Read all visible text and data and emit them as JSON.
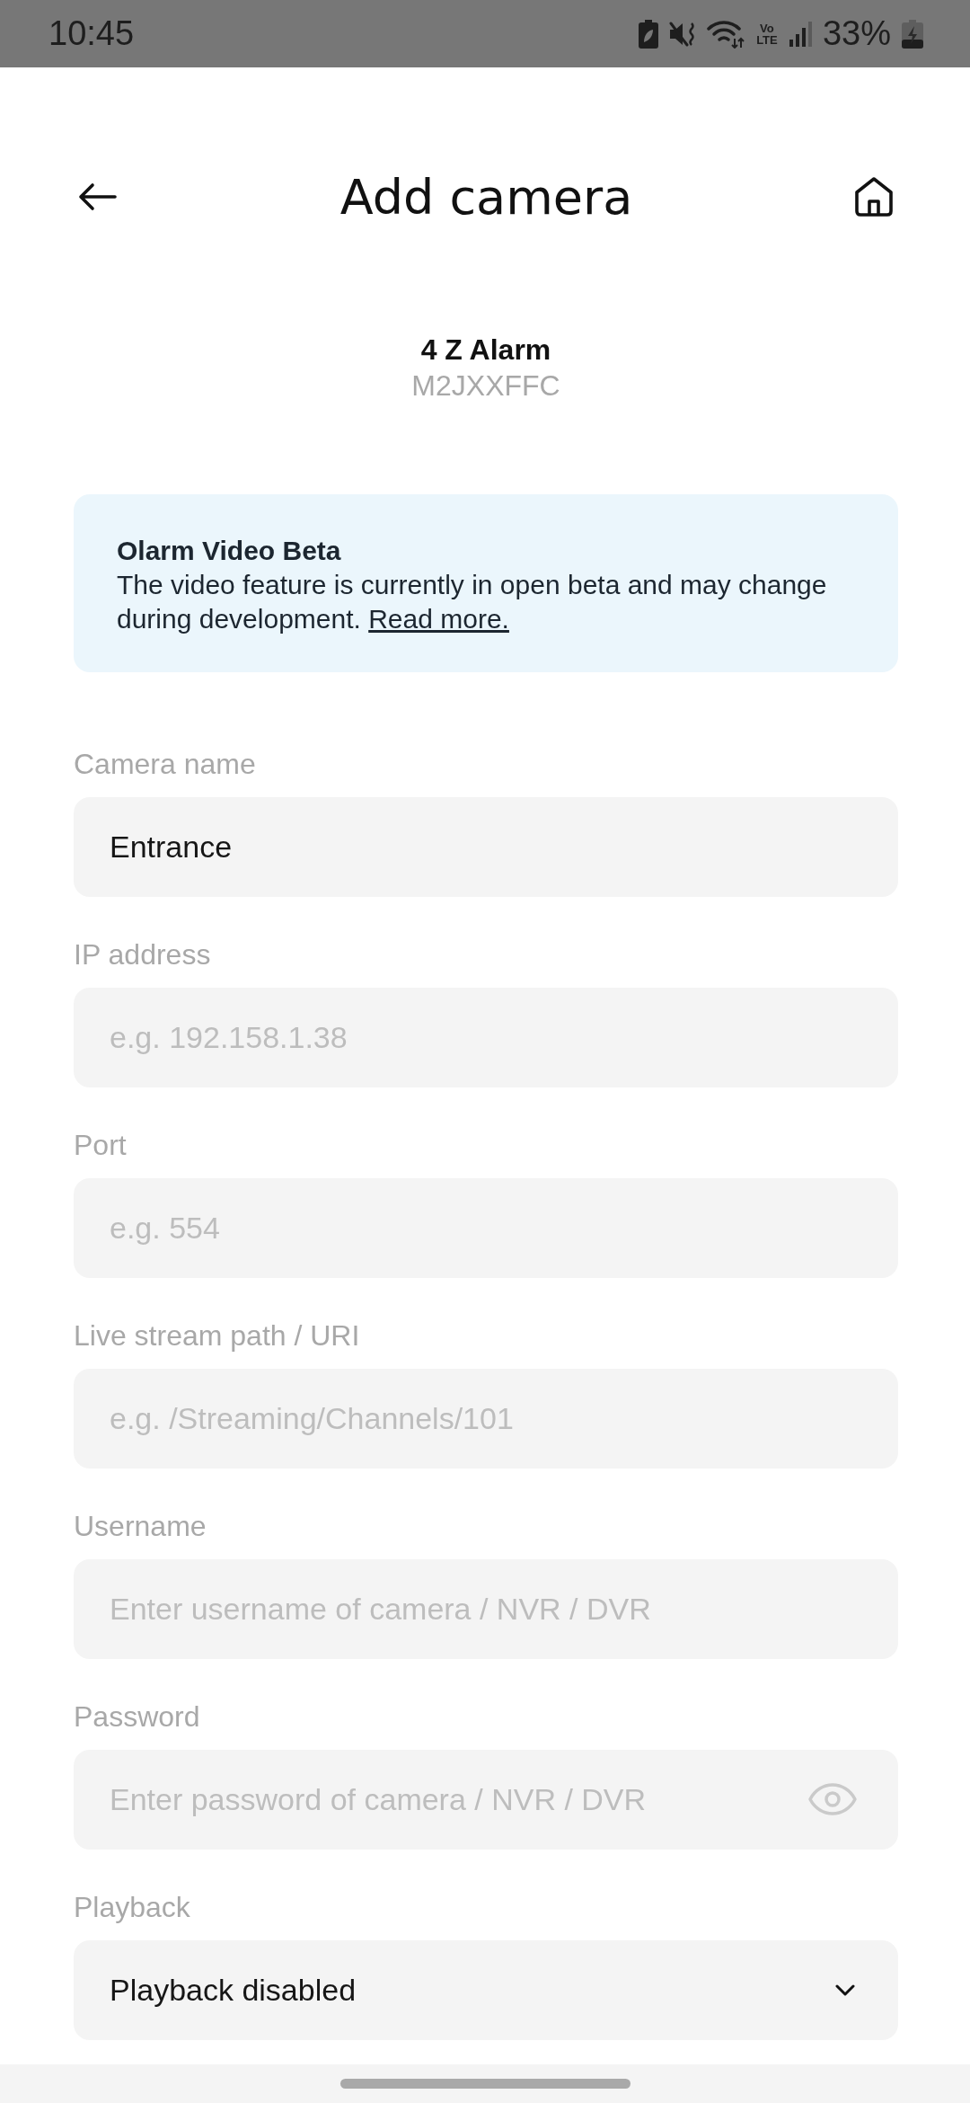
{
  "status_bar": {
    "time": "10:45",
    "network": "Vo LTE",
    "battery": "33%"
  },
  "header": {
    "title": "Add camera"
  },
  "device": {
    "name": "4 Z Alarm",
    "serial": "M2JXXFFC"
  },
  "notice": {
    "title": "Olarm Video Beta",
    "text": "The video feature is currently in open beta and may change during development.",
    "link": "Read more."
  },
  "fields": [
    {
      "kind": "text",
      "label": "Camera name",
      "value": "Entrance"
    },
    {
      "kind": "text",
      "label": "IP address",
      "placeholder": "e.g. 192.158.1.38"
    },
    {
      "kind": "text",
      "label": "Port",
      "placeholder": "e.g. 554"
    },
    {
      "kind": "text",
      "label": "Live stream path / URI",
      "placeholder": "e.g. /Streaming/Channels/101"
    },
    {
      "kind": "text",
      "label": "Username",
      "placeholder": "Enter username of camera / NVR / DVR"
    },
    {
      "kind": "password",
      "label": "Password",
      "placeholder": "Enter password of camera / NVR / DVR"
    },
    {
      "kind": "select",
      "label": "Playback",
      "value": "Playback disabled"
    }
  ]
}
